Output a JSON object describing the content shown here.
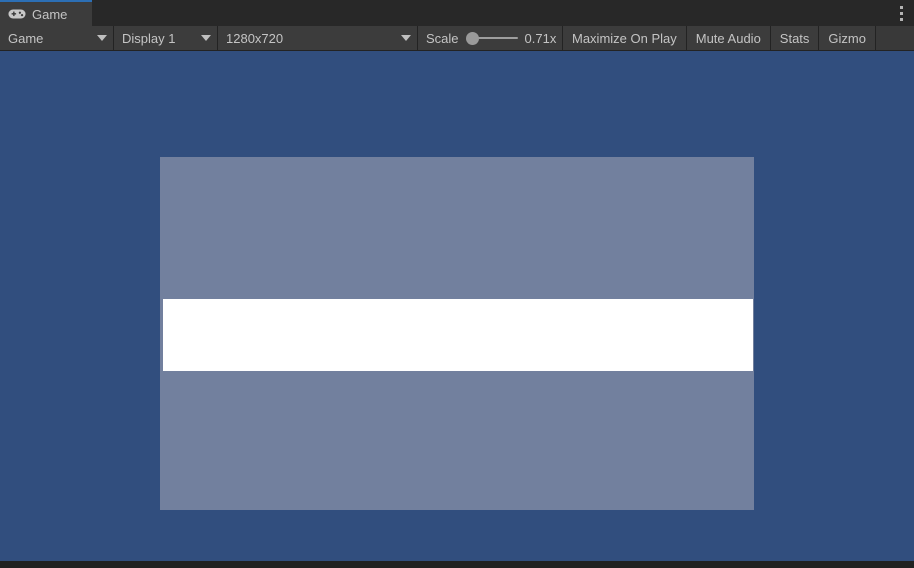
{
  "window": {
    "tab": {
      "label": "Game",
      "icon": "gamepad-icon",
      "accent_color": "#2C6FB5"
    },
    "options_menu_icon": "kebab-menu-icon"
  },
  "toolbar": {
    "view_type": {
      "value": "Game",
      "icon": "chevron-down-icon"
    },
    "display": {
      "value": "Display 1",
      "icon": "chevron-down-icon"
    },
    "resolution": {
      "value": "1280x720",
      "icon": "chevron-down-icon"
    },
    "scale": {
      "label": "Scale",
      "value": "0.71x",
      "slider_position_percent": 0
    },
    "buttons": [
      {
        "label": "Maximize On Play",
        "name": "maximize-on-play-button"
      },
      {
        "label": "Mute Audio",
        "name": "mute-audio-button"
      },
      {
        "label": "Stats",
        "name": "stats-button"
      },
      {
        "label": "Gizmo",
        "name": "gizmos-button"
      }
    ]
  },
  "gameview": {
    "background_color": "#314E7E",
    "render_color": "#72809E",
    "band_color": "#FFFFFF"
  }
}
